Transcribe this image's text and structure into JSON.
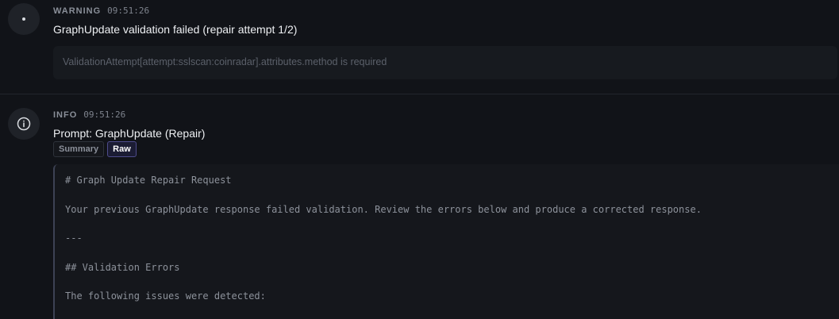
{
  "entries": [
    {
      "level": "WARNING",
      "time": "09:51:26",
      "title": "GraphUpdate validation failed (repair attempt 1/2)",
      "detail": "ValidationAttempt[attempt:sslscan:coinradar].attributes.method is required",
      "icon": "dot-icon"
    },
    {
      "level": "INFO",
      "time": "09:51:26",
      "title": "Prompt: GraphUpdate (Repair)",
      "icon": "info-icon",
      "tabs": [
        "Summary",
        "Raw"
      ],
      "active_tab": "Raw",
      "raw_lines": [
        "# Graph Update Repair Request",
        "Your previous GraphUpdate response failed validation. Review the errors below and produce a corrected response.",
        "---",
        "## Validation Errors",
        "The following issues were detected:"
      ]
    }
  ],
  "colors": {
    "background": "#111318",
    "text_primary": "#eef0f3",
    "text_muted": "#8a8f99",
    "accent_tab": "#4e4c8c"
  }
}
